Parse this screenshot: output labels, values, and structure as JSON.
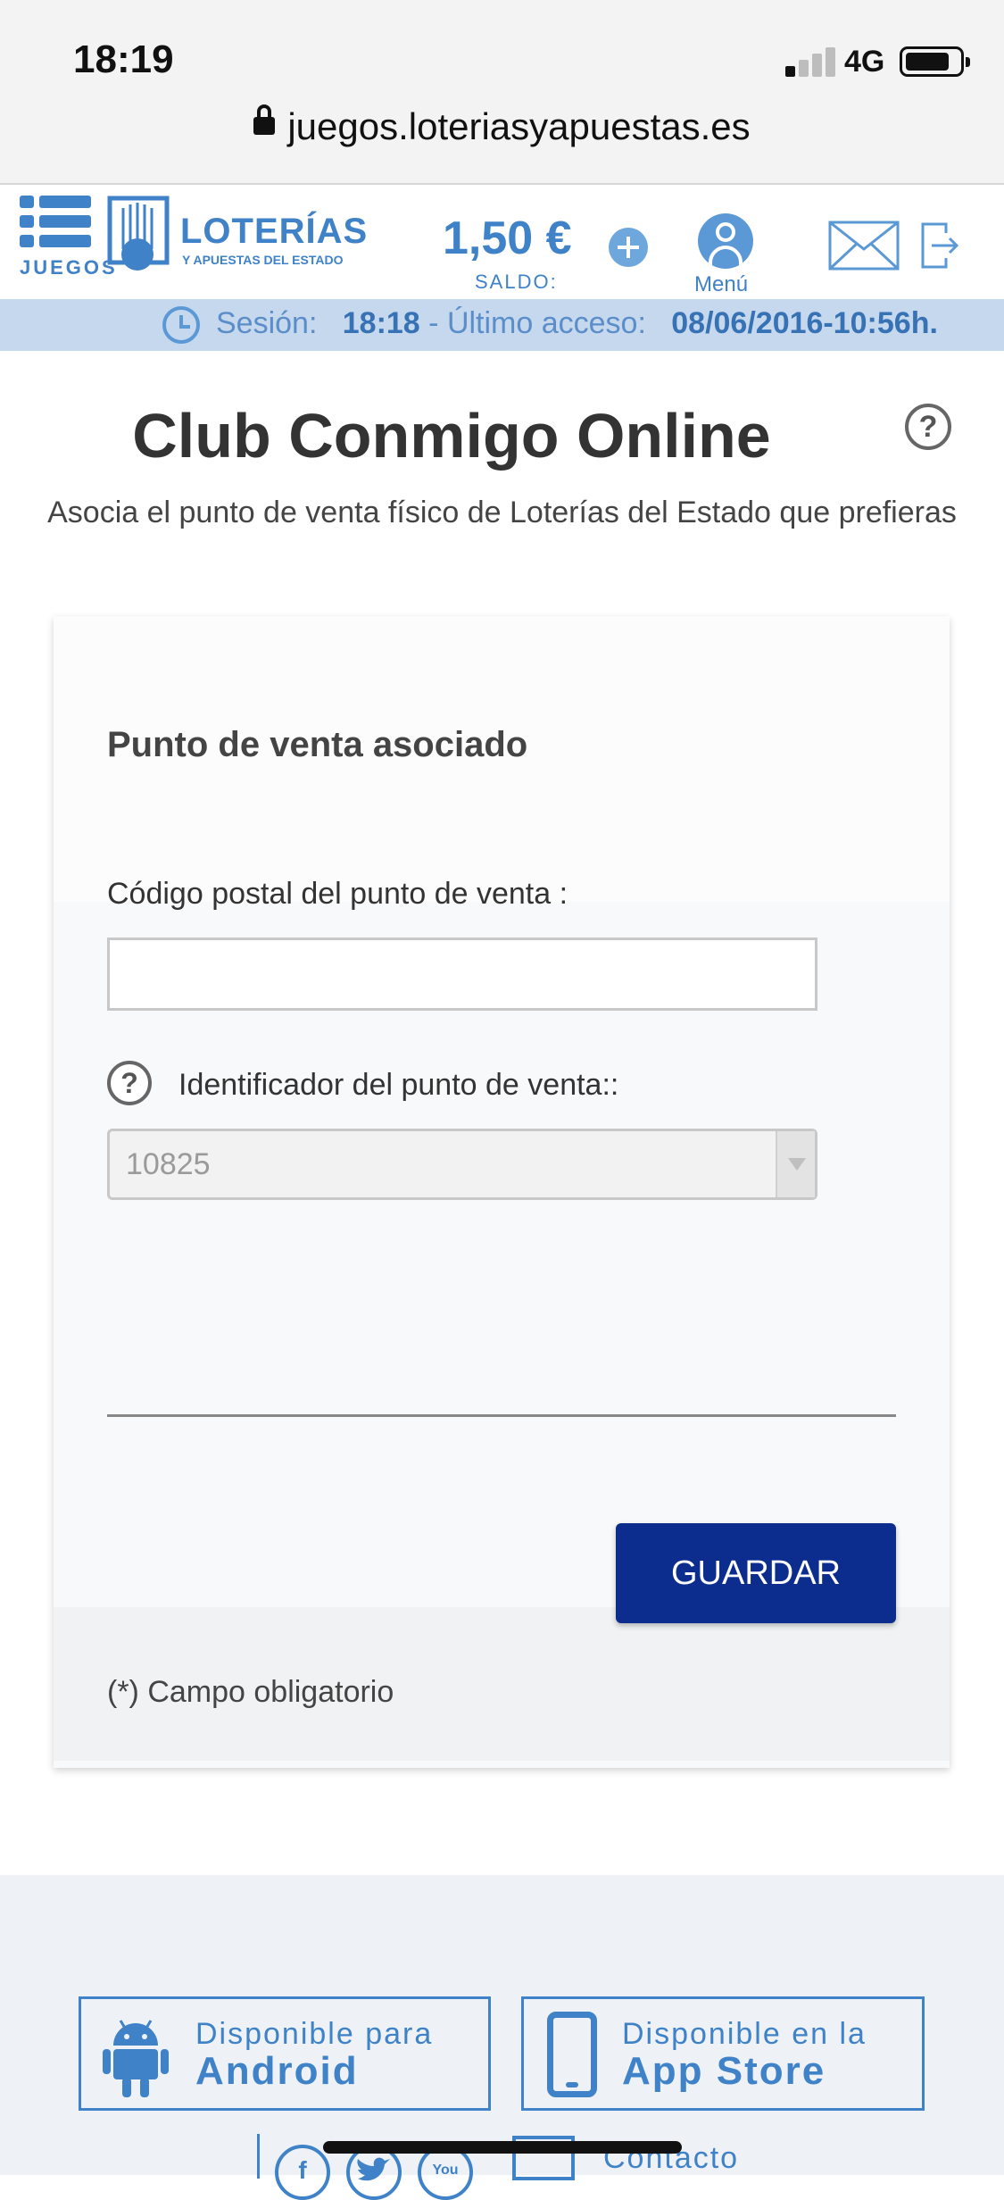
{
  "status_bar": {
    "time": "18:19",
    "network": "4G"
  },
  "browser": {
    "url": "juegos.loteriasyapuestas.es"
  },
  "header": {
    "menu_label": "JUEGOS",
    "logo_title": "LOTERÍAS",
    "logo_subtitle": "Y APUESTAS DEL ESTADO",
    "balance": "1,50 €",
    "balance_label": "SALDO:",
    "user_menu_label": "Menú"
  },
  "session_bar": {
    "session_label": "Sesión:",
    "session_time": "18:18",
    "separator": " - ",
    "last_access_label": "Último acceso:",
    "last_access_value": "08/06/2016-10:56h."
  },
  "main": {
    "title": "Club Conmigo Online",
    "help_glyph": "?",
    "subtitle": "Asocia el punto de venta físico de Loterías del Estado que prefieras"
  },
  "form": {
    "section_title": "Punto de venta asociado",
    "postal_code_label": "Código postal del punto de venta :",
    "postal_code_value": "",
    "identifier_label": "Identificador del punto de venta::",
    "identifier_value": "10825",
    "save_label": "GUARDAR",
    "required_note": "(*) Campo obligatorio"
  },
  "footer": {
    "android_line1": "Disponible para",
    "android_line2": "Android",
    "apple_line1": "Disponible en la",
    "apple_line2": "App Store",
    "social_facebook": "f",
    "social_youtube": "You",
    "contact_label": "Contacto"
  },
  "colors": {
    "brand_blue": "#3f82c8",
    "button_navy": "#0d2d8e",
    "session_bg": "#c5d8ee"
  }
}
